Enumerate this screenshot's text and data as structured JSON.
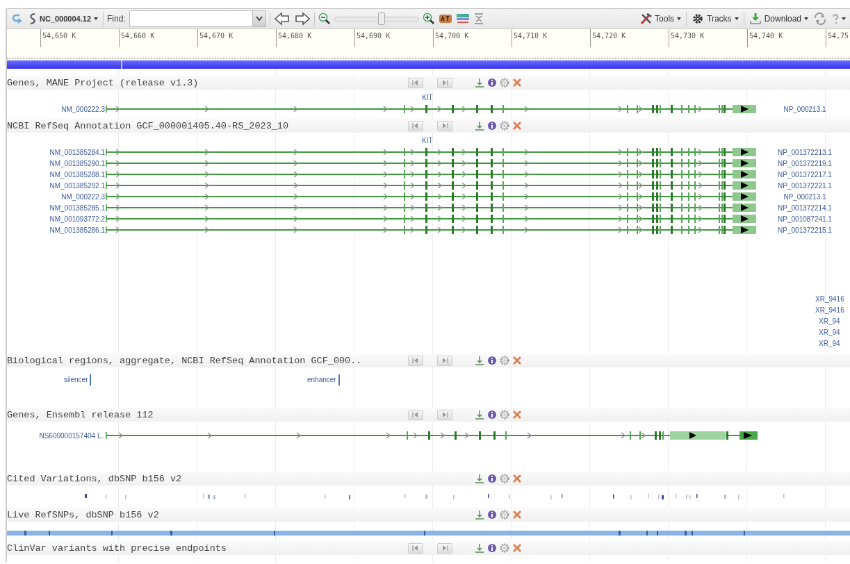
{
  "toolbar": {
    "sequence": "NC_000004.12",
    "find_label": "Find:",
    "zoom": {
      "level": 0.55
    },
    "menus": [
      {
        "kind": "tools",
        "label": "Tools"
      },
      {
        "kind": "tracks",
        "label": "Tracks"
      },
      {
        "kind": "download",
        "label": "Download"
      }
    ]
  },
  "ruler": {
    "ticks": [
      "54,650 K",
      "54,660 K",
      "54,670 K",
      "54,680 K",
      "54,690 K",
      "54,700 K",
      "54,710 K",
      "54,720 K",
      "54,730 K",
      "54,740 K",
      "54,75"
    ]
  },
  "tracks": [
    {
      "kind": "gene",
      "title": "Genes, MANE Project (release v1.3)",
      "paging": true,
      "gene": "KIT",
      "transcripts": [
        {
          "left": "NM_000222.3",
          "right": "NP_000213.1"
        }
      ]
    },
    {
      "kind": "gene",
      "title": "NCBI RefSeq Annotation GCF_000001405.40-RS_2023_10",
      "paging": true,
      "gene": "KIT",
      "transcripts": [
        {
          "left": "NM_001385284.1",
          "right": "NP_001372213.1"
        },
        {
          "left": "NM_001385290.1",
          "right": "NP_001372219.1"
        },
        {
          "left": "NM_001385288.1",
          "right": "NP_001372217.1"
        },
        {
          "left": "NM_001385292.1",
          "right": "NP_001372221.1"
        },
        {
          "left": "NM_000222.3",
          "right": "NP_000213.1"
        },
        {
          "left": "NM_001385285.1",
          "right": "NP_001372214.1"
        },
        {
          "left": "NM_001093772.2",
          "right": "NP_001087241.1"
        },
        {
          "left": "NM_001385286.1",
          "right": "NP_001372215.1"
        }
      ],
      "more_labels": [
        "XR_9416",
        "XR_9416",
        "XR_94",
        "XR_94",
        "XR_94"
      ]
    },
    {
      "kind": "regions",
      "title": "Biological regions, aggregate, NCBI RefSeq Annotation GCF_000..",
      "paging": true,
      "features": [
        {
          "label": "silencer"
        },
        {
          "label": "enhancer"
        }
      ]
    },
    {
      "kind": "gene",
      "title": "Genes, Ensembl release 112",
      "paging": true,
      "transcripts": [
        {
          "left": "NS600000157404 L.."
        }
      ]
    },
    {
      "kind": "variants",
      "title": "Cited Variations, dbSNP b156 v2",
      "paging": false
    },
    {
      "kind": "density",
      "title": "Live RefSNPs, dbSNP b156 v2",
      "paging": false
    },
    {
      "kind": "empty",
      "title": "ClinVar variants with precise endpoints",
      "paging": true
    }
  ]
}
